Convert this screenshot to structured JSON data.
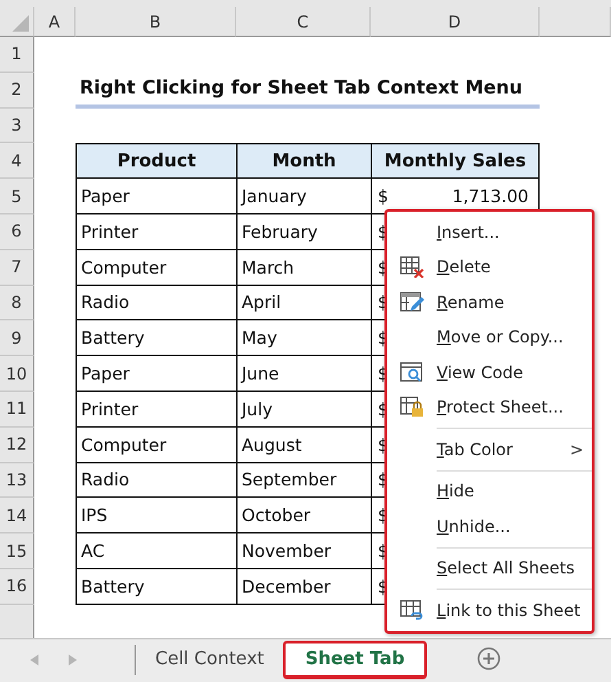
{
  "columns": [
    "A",
    "B",
    "C",
    "D"
  ],
  "title_row": "2",
  "title": "Right Clicking for Sheet Tab Context Menu",
  "empty_rows": [
    "1",
    "3"
  ],
  "header_row": "4",
  "table_headers": [
    "Product",
    "Month",
    "Monthly Sales"
  ],
  "rows": [
    {
      "row": "5",
      "product": "Paper",
      "month": "January",
      "currency": "$",
      "amount": "1,713.00"
    },
    {
      "row": "6",
      "product": "Printer",
      "month": "February",
      "currency": "$"
    },
    {
      "row": "7",
      "product": "Computer",
      "month": "March",
      "currency": "$"
    },
    {
      "row": "8",
      "product": "Radio",
      "month": "April",
      "currency": "$"
    },
    {
      "row": "9",
      "product": "Battery",
      "month": "May",
      "currency": "$"
    },
    {
      "row": "10",
      "product": "Paper",
      "month": "June",
      "currency": "$"
    },
    {
      "row": "11",
      "product": "Printer",
      "month": "July",
      "currency": "$"
    },
    {
      "row": "12",
      "product": "Computer",
      "month": "August",
      "currency": "$"
    },
    {
      "row": "13",
      "product": "Radio",
      "month": "September",
      "currency": "$"
    },
    {
      "row": "14",
      "product": "IPS",
      "month": "October",
      "currency": "$"
    },
    {
      "row": "15",
      "product": "AC",
      "month": "November",
      "currency": "$"
    },
    {
      "row": "16",
      "product": "Battery",
      "month": "December",
      "currency": "$"
    }
  ],
  "context_menu": [
    {
      "label": "Insert..."
    },
    {
      "label": "Delete"
    },
    {
      "label": "Rename"
    },
    {
      "label": "Move or Copy..."
    },
    {
      "label": "View Code"
    },
    {
      "label": "Protect Sheet..."
    },
    {
      "label": "Tab Color",
      "separator_before": true,
      "submenu": ">"
    },
    {
      "label": "Hide",
      "separator_before": true
    },
    {
      "label": "Unhide..."
    },
    {
      "label": "Select All Sheets",
      "separator_before": true
    },
    {
      "label": "Link to this Sheet",
      "separator_before": true
    }
  ],
  "sheet_tabs": [
    {
      "label": "Cell Context",
      "selected": false
    },
    {
      "label": "Sheet Tab",
      "selected": true
    }
  ]
}
